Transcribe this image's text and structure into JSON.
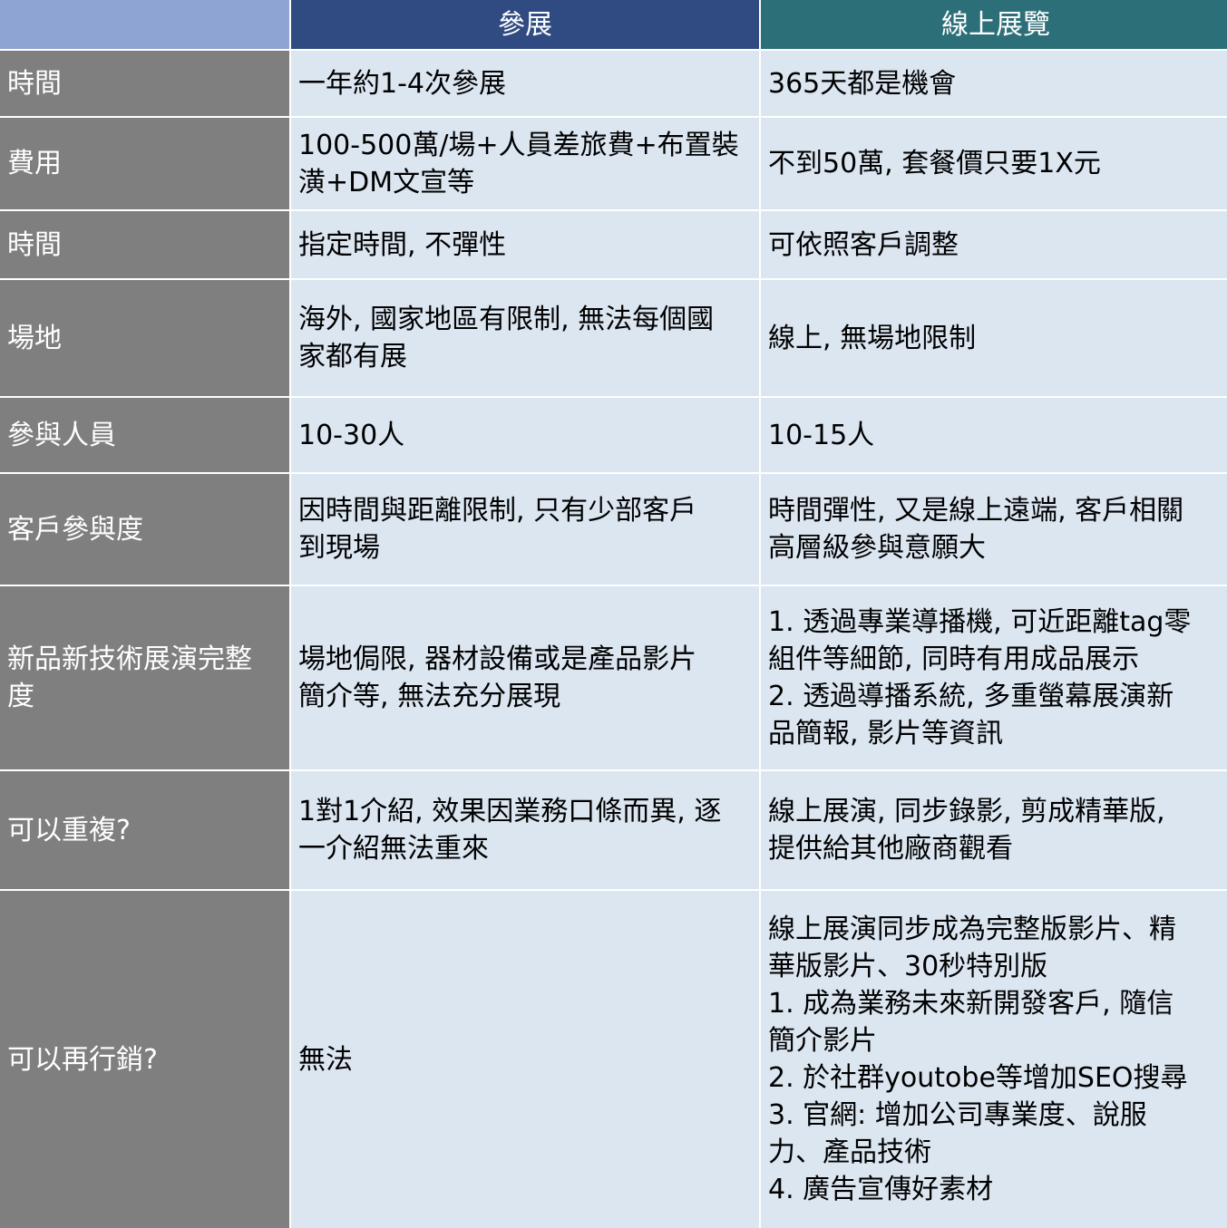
{
  "header": {
    "col_expo": "參展",
    "col_online": "線上展覽"
  },
  "rows": [
    {
      "label": "時間",
      "expo": "一年約1-4次參展",
      "online": "365天都是機會"
    },
    {
      "label": "費用",
      "expo": "100-500萬/場+人員差旅費+布置裝\n潢+DM文宣等",
      "online": "不到50萬, 套餐價只要1X元"
    },
    {
      "label": "時間",
      "expo": "指定時間, 不彈性",
      "online": "可依照客戶調整"
    },
    {
      "label": "場地",
      "expo": "海外, 國家地區有限制, 無法每個國\n家都有展",
      "online": "線上, 無場地限制"
    },
    {
      "label": "參與人員",
      "expo": "10-30人",
      "online": "10-15人"
    },
    {
      "label": "客戶參與度",
      "expo": "因時間與距離限制, 只有少部客戶\n到現場",
      "online": "時間彈性, 又是線上遠端, 客戶相關\n高層級參與意願大"
    },
    {
      "label": "新品新技術展演完整\n度",
      "expo": "場地侷限, 器材設備或是產品影片\n簡介等, 無法充分展現",
      "online": "1. 透過專業導播機, 可近距離tag零\n組件等細節, 同時有用成品展示\n2. 透過導播系統, 多重螢幕展演新\n品簡報, 影片等資訊"
    },
    {
      "label": "可以重複?",
      "expo": "1對1介紹, 效果因業務口條而異, 逐\n一介紹無法重來",
      "online": "線上展演, 同步錄影, 剪成精華版,\n提供給其他廠商觀看"
    },
    {
      "label": "可以再行銷?",
      "expo": "無法",
      "online": "線上展演同步成為完整版影片、精\n華版影片、30秒特別版\n1. 成為業務未來新開發客戶, 隨信\n簡介影片\n2. 於社群youtobe等增加SEO搜尋\n3. 官網: 增加公司專業度、說服\n力、產品技術\n4. 廣告宣傳好素材"
    }
  ]
}
